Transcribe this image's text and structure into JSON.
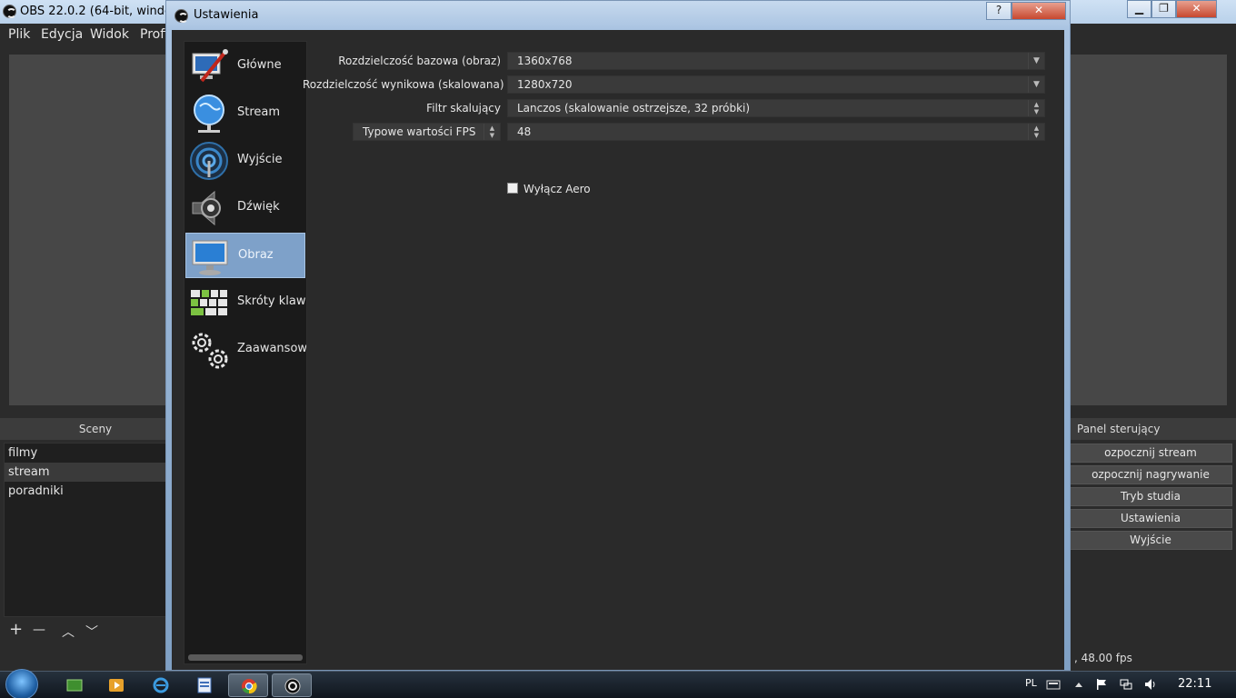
{
  "obs_window": {
    "title": "OBS 22.0.2 (64-bit, windo",
    "menu": [
      "Plik",
      "Edycja",
      "Widok",
      "Profi"
    ],
    "window_buttons": {
      "minimize": "▁",
      "maximize": "❐",
      "close": "✕"
    }
  },
  "scenes": {
    "title": "Sceny",
    "items": [
      "filmy",
      "stream",
      "poradniki"
    ],
    "selected_index": 1,
    "toolbar": {
      "add": "+",
      "remove": "—",
      "up": "︿",
      "down": "﹀"
    }
  },
  "controls": {
    "title": "Panel sterujący",
    "buttons": [
      "ozpocznij stream",
      "ozpocznij nagrywanie",
      "Tryb studia",
      "Ustawienia",
      "Wyjście"
    ]
  },
  "status": {
    "fps": ", 48.00 fps"
  },
  "settings": {
    "title": "Ustawienia",
    "help_button": "?",
    "close_button": "✕",
    "nav": [
      {
        "label": "Główne",
        "icon": "general-icon"
      },
      {
        "label": "Stream",
        "icon": "stream-globe-icon"
      },
      {
        "label": "Wyjście",
        "icon": "output-antenna-icon"
      },
      {
        "label": "Dźwięk",
        "icon": "speaker-icon"
      },
      {
        "label": "Obraz",
        "icon": "monitor-icon"
      },
      {
        "label": "Skróty klawis",
        "icon": "keyboard-icon"
      },
      {
        "label": "Zaawansowa",
        "icon": "gears-icon"
      }
    ],
    "selected_nav_index": 4,
    "video": {
      "base_resolution_label": "Rozdzielczość bazowa (obraz)",
      "base_resolution_value": "1360x768",
      "output_resolution_label": "Rozdzielczość wynikowa (skalowana)",
      "output_resolution_value": "1280x720",
      "downscale_filter_label": "Filtr skalujący",
      "downscale_filter_value": "Lanczos (skalowanie ostrzejsze, 32 próbki)",
      "fps_type_value": "Typowe wartości FPS",
      "fps_value": "48",
      "disable_aero_label": "Wyłącz Aero",
      "disable_aero_checked": false
    }
  },
  "taskbar": {
    "language": "PL",
    "clock": "22:11",
    "pinned": [
      "green-app-icon",
      "media-player-icon",
      "internet-explorer-icon",
      "word-icon",
      "chrome-icon",
      "obs-icon"
    ],
    "active_indices": [
      4,
      5
    ]
  }
}
